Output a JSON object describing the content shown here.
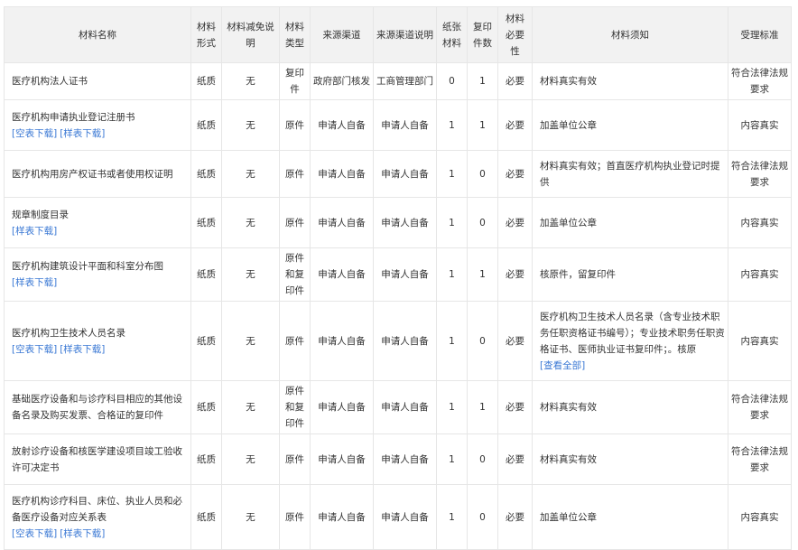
{
  "headers": [
    "材料名称",
    "材料形式",
    "材料减免说明",
    "材料类型",
    "来源渠道",
    "来源渠道说明",
    "纸张材料",
    "复印件数",
    "材料必要性",
    "材料须知",
    "受理标准"
  ],
  "rows": [
    {
      "name": "医疗机构法人证书",
      "links": [],
      "form": "纸质",
      "reduce": "无",
      "type": "复印件",
      "source": "政府部门核发",
      "source_note": "工商管理部门",
      "paper": "0",
      "copies": "1",
      "necessity": "必要",
      "note": "材料真实有效",
      "note_link": "",
      "standard": "符合法律法规要求"
    },
    {
      "name": "医疗机构申请执业登记注册书",
      "links": [
        "[空表下载]",
        "[样表下载]"
      ],
      "form": "纸质",
      "reduce": "无",
      "type": "原件",
      "source": "申请人自备",
      "source_note": "申请人自备",
      "paper": "1",
      "copies": "1",
      "necessity": "必要",
      "note": "加盖单位公章",
      "note_link": "",
      "standard": "内容真实"
    },
    {
      "name": "医疗机构用房产权证书或者使用权证明",
      "links": [],
      "form": "纸质",
      "reduce": "无",
      "type": "原件",
      "source": "申请人自备",
      "source_note": "申请人自备",
      "paper": "1",
      "copies": "0",
      "necessity": "必要",
      "note": "材料真实有效；首直医疗机构执业登记时提供",
      "note_link": "",
      "standard": "符合法律法规要求"
    },
    {
      "name": "规章制度目录",
      "links": [
        "[样表下载]"
      ],
      "form": "纸质",
      "reduce": "无",
      "type": "原件",
      "source": "申请人自备",
      "source_note": "申请人自备",
      "paper": "1",
      "copies": "0",
      "necessity": "必要",
      "note": "加盖单位公章",
      "note_link": "",
      "standard": "内容真实"
    },
    {
      "name": "医疗机构建筑设计平面和科室分布图",
      "links": [
        "[样表下载]"
      ],
      "form": "纸质",
      "reduce": "无",
      "type": "原件和复印件",
      "source": "申请人自备",
      "source_note": "申请人自备",
      "paper": "1",
      "copies": "1",
      "necessity": "必要",
      "note": "核原件，留复印件",
      "note_link": "",
      "standard": "内容真实"
    },
    {
      "name": "医疗机构卫生技术人员名录",
      "links": [
        "[空表下载]",
        "[样表下载]"
      ],
      "form": "纸质",
      "reduce": "无",
      "type": "原件",
      "source": "申请人自备",
      "source_note": "申请人自备",
      "paper": "1",
      "copies": "0",
      "necessity": "必要",
      "note": "医疗机构卫生技术人员名录（含专业技术职务任职资格证书编号）；专业技术职务任职资格证书、医师执业证书复印件；。核原",
      "note_link": "[查看全部]",
      "standard": "内容真实"
    },
    {
      "name": "基础医疗设备和与诊疗科目相应的其他设备名录及购买发票、合格证的复印件",
      "links": [],
      "form": "纸质",
      "reduce": "无",
      "type": "原件和复印件",
      "source": "申请人自备",
      "source_note": "申请人自备",
      "paper": "1",
      "copies": "1",
      "necessity": "必要",
      "note": "材料真实有效",
      "note_link": "",
      "standard": "符合法律法规要求"
    },
    {
      "name": "放射诊疗设备和核医学建设项目竣工验收许可决定书",
      "links": [],
      "form": "纸质",
      "reduce": "无",
      "type": "原件",
      "source": "申请人自备",
      "source_note": "申请人自备",
      "paper": "1",
      "copies": "0",
      "necessity": "必要",
      "note": "材料真实有效",
      "note_link": "",
      "standard": "符合法律法规要求"
    },
    {
      "name": "医疗机构诊疗科目、床位、执业人员和必备医疗设备对应关系表",
      "links": [
        "[空表下载]",
        "[样表下载]"
      ],
      "form": "纸质",
      "reduce": "无",
      "type": "原件",
      "source": "申请人自备",
      "source_note": "申请人自备",
      "paper": "1",
      "copies": "0",
      "necessity": "必要",
      "note": "加盖单位公章",
      "note_link": "",
      "standard": "内容真实"
    }
  ]
}
